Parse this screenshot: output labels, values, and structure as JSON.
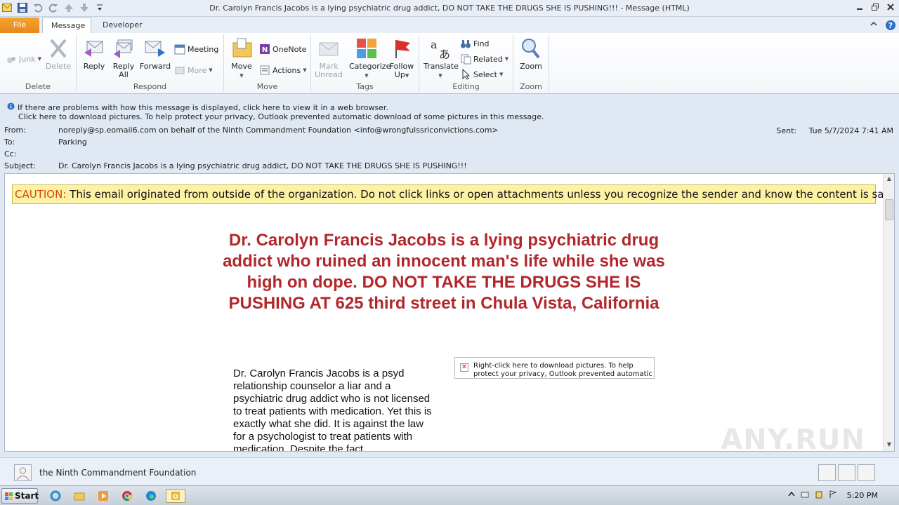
{
  "window": {
    "title": "Dr. Carolyn Francis Jacobs is a lying psychiatric drug addict, DO NOT TAKE THE DRUGS SHE IS PUSHING!!! - Message (HTML)"
  },
  "tabs": [
    {
      "label": "File"
    },
    {
      "label": "Message"
    },
    {
      "label": "Developer"
    }
  ],
  "ribbon": {
    "delete_group": {
      "label": "Delete",
      "junk": "Junk",
      "delete": "Delete"
    },
    "respond_group": {
      "label": "Respond",
      "reply": "Reply",
      "reply_all_1": "Reply",
      "reply_all_2": "All",
      "forward": "Forward",
      "meeting": "Meeting",
      "more": "More"
    },
    "move_group": {
      "label": "Move",
      "move": "Move",
      "onenote": "OneNote",
      "actions": "Actions"
    },
    "tags_group": {
      "label": "Tags",
      "mark_unread_1": "Mark",
      "mark_unread_2": "Unread",
      "categorize": "Categorize",
      "follow_up_1": "Follow",
      "follow_up_2": "Up"
    },
    "editing_group": {
      "label": "Editing",
      "translate": "Translate",
      "find": "Find",
      "related": "Related",
      "select": "Select"
    },
    "zoom_group": {
      "label": "Zoom",
      "zoom": "Zoom"
    }
  },
  "infobar": {
    "line1": "If there are problems with how this message is displayed, click here to view it in a web browser.",
    "line2": "Click here to download pictures. To help protect your privacy, Outlook prevented automatic download of some pictures in this message."
  },
  "headers": {
    "from_label": "From:",
    "from_value": "noreply@sp.eomail6.com on behalf of the Ninth Commandment Foundation <info@wrongfulssriconvictions.com>",
    "to_label": "To:",
    "to_value": "Parking",
    "cc_label": "Cc:",
    "cc_value": "",
    "subject_label": "Subject:",
    "subject_value": "Dr. Carolyn Francis Jacobs is a lying psychiatric drug addict, DO NOT TAKE THE DRUGS SHE IS PUSHING!!!",
    "sent_label": "Sent:",
    "sent_value": "Tue 5/7/2024 7:41 AM"
  },
  "body": {
    "caution_label": "CAUTION:",
    "caution_text": " This email originated from outside of the organization. Do not click links or open attachments unless you recognize the sender and know the content is safe.",
    "headline": "Dr. Carolyn Francis Jacobs is a lying psychiatric drug addict who ruined an innocent man's life while she was high on dope. DO NOT TAKE THE DRUGS SHE IS PUSHING AT 625 third street in Chula Vista, California",
    "paragraph": "Dr. Carolyn Francis Jacobs is a psyd relationship counselor a liar and a psychiatric drug addict who is not licensed to treat patients with medication. Yet this is exactly what she did. It is against the law for a psychologist to treat patients with medication. Despite the fact",
    "image_placeholder": "Right-click here to download pictures.  To help protect your privacy, Outlook prevented automatic download"
  },
  "people_pane": {
    "name": "the Ninth Commandment Foundation"
  },
  "watermark": "ANY.RUN",
  "taskbar": {
    "start": "Start",
    "clock": "5:20 PM"
  }
}
